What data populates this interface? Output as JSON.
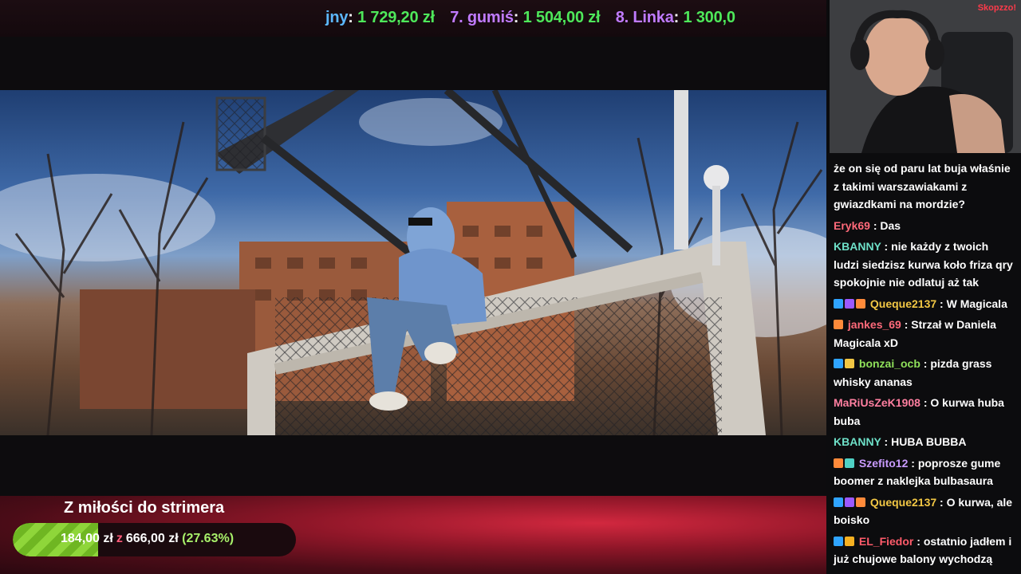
{
  "ticker": {
    "entries": [
      {
        "rank": "",
        "name": "jny",
        "amount": "1 729,20 zł",
        "color": "#5cb8ff"
      },
      {
        "rank": "7.",
        "name": "gumiś",
        "amount": "1 504,00 zł",
        "color": "#c07bff"
      },
      {
        "rank": "8.",
        "name": "Linka",
        "amount": "1 300,0",
        "color": "#c07bff"
      }
    ],
    "colon": ":"
  },
  "goal": {
    "title": "Z miłości do strimera",
    "current": "184,00 zł",
    "separator": "z",
    "target": "666,00 zł",
    "percent_label": "(27.63%)",
    "progress": 0.2763,
    "fill_color": "#8fd63a"
  },
  "camera": {
    "badge": "Skopzzo!"
  },
  "chat": {
    "messages": [
      {
        "user": "",
        "color": "#ffffff",
        "badges": [],
        "text": "że on się od paru lat buja właśnie z takimi warszawiakami z gwiazdkami na mordzie?"
      },
      {
        "user": "Eryk69",
        "color": "#ff6a7a",
        "badges": [],
        "text": "Das"
      },
      {
        "user": "KBANNY",
        "color": "#6ee0c8",
        "badges": [],
        "text": "nie każdy z twoich ludzi siedzisz kurwa koło friza qry spokojnie nie odlatuj aż tak"
      },
      {
        "user": "Queque2137",
        "color": "#f2c744",
        "badges": [
          "verified-icon",
          "sub-icon",
          "flame-icon"
        ],
        "text": "W Magicala"
      },
      {
        "user": "jankes_69",
        "color": "#ff6a7a",
        "badges": [
          "flame-icon"
        ],
        "text": "Strzał w Daniela Magicala xD"
      },
      {
        "user": "bonzai_ocb",
        "color": "#8fe05a",
        "badges": [
          "cube-icon",
          "crown-icon"
        ],
        "text": "pizda grass whisky ananas"
      },
      {
        "user": "MaRiUsZeK1908",
        "color": "#ff7fa0",
        "badges": [],
        "text": "O kurwa huba buba"
      },
      {
        "user": "KBANNY",
        "color": "#6ee0c8",
        "badges": [],
        "text": "HUBA BUBBA"
      },
      {
        "user": "Szefito12",
        "color": "#c99bff",
        "badges": [
          "flame-icon",
          "grid-icon"
        ],
        "text": "poprosze gume boomer z naklejka bulbasaura"
      },
      {
        "user": "Queque2137",
        "color": "#f2c744",
        "badges": [
          "verified-icon",
          "sub-icon",
          "flame-icon"
        ],
        "text": "O kurwa, ale boisko"
      },
      {
        "user": "EL_Fiedor",
        "color": "#ff5b6a",
        "badges": [
          "cube-icon",
          "coin-icon"
        ],
        "text": "ostatnio jadłem i już chujowe balony wychodzą"
      }
    ],
    "separator": " : "
  }
}
